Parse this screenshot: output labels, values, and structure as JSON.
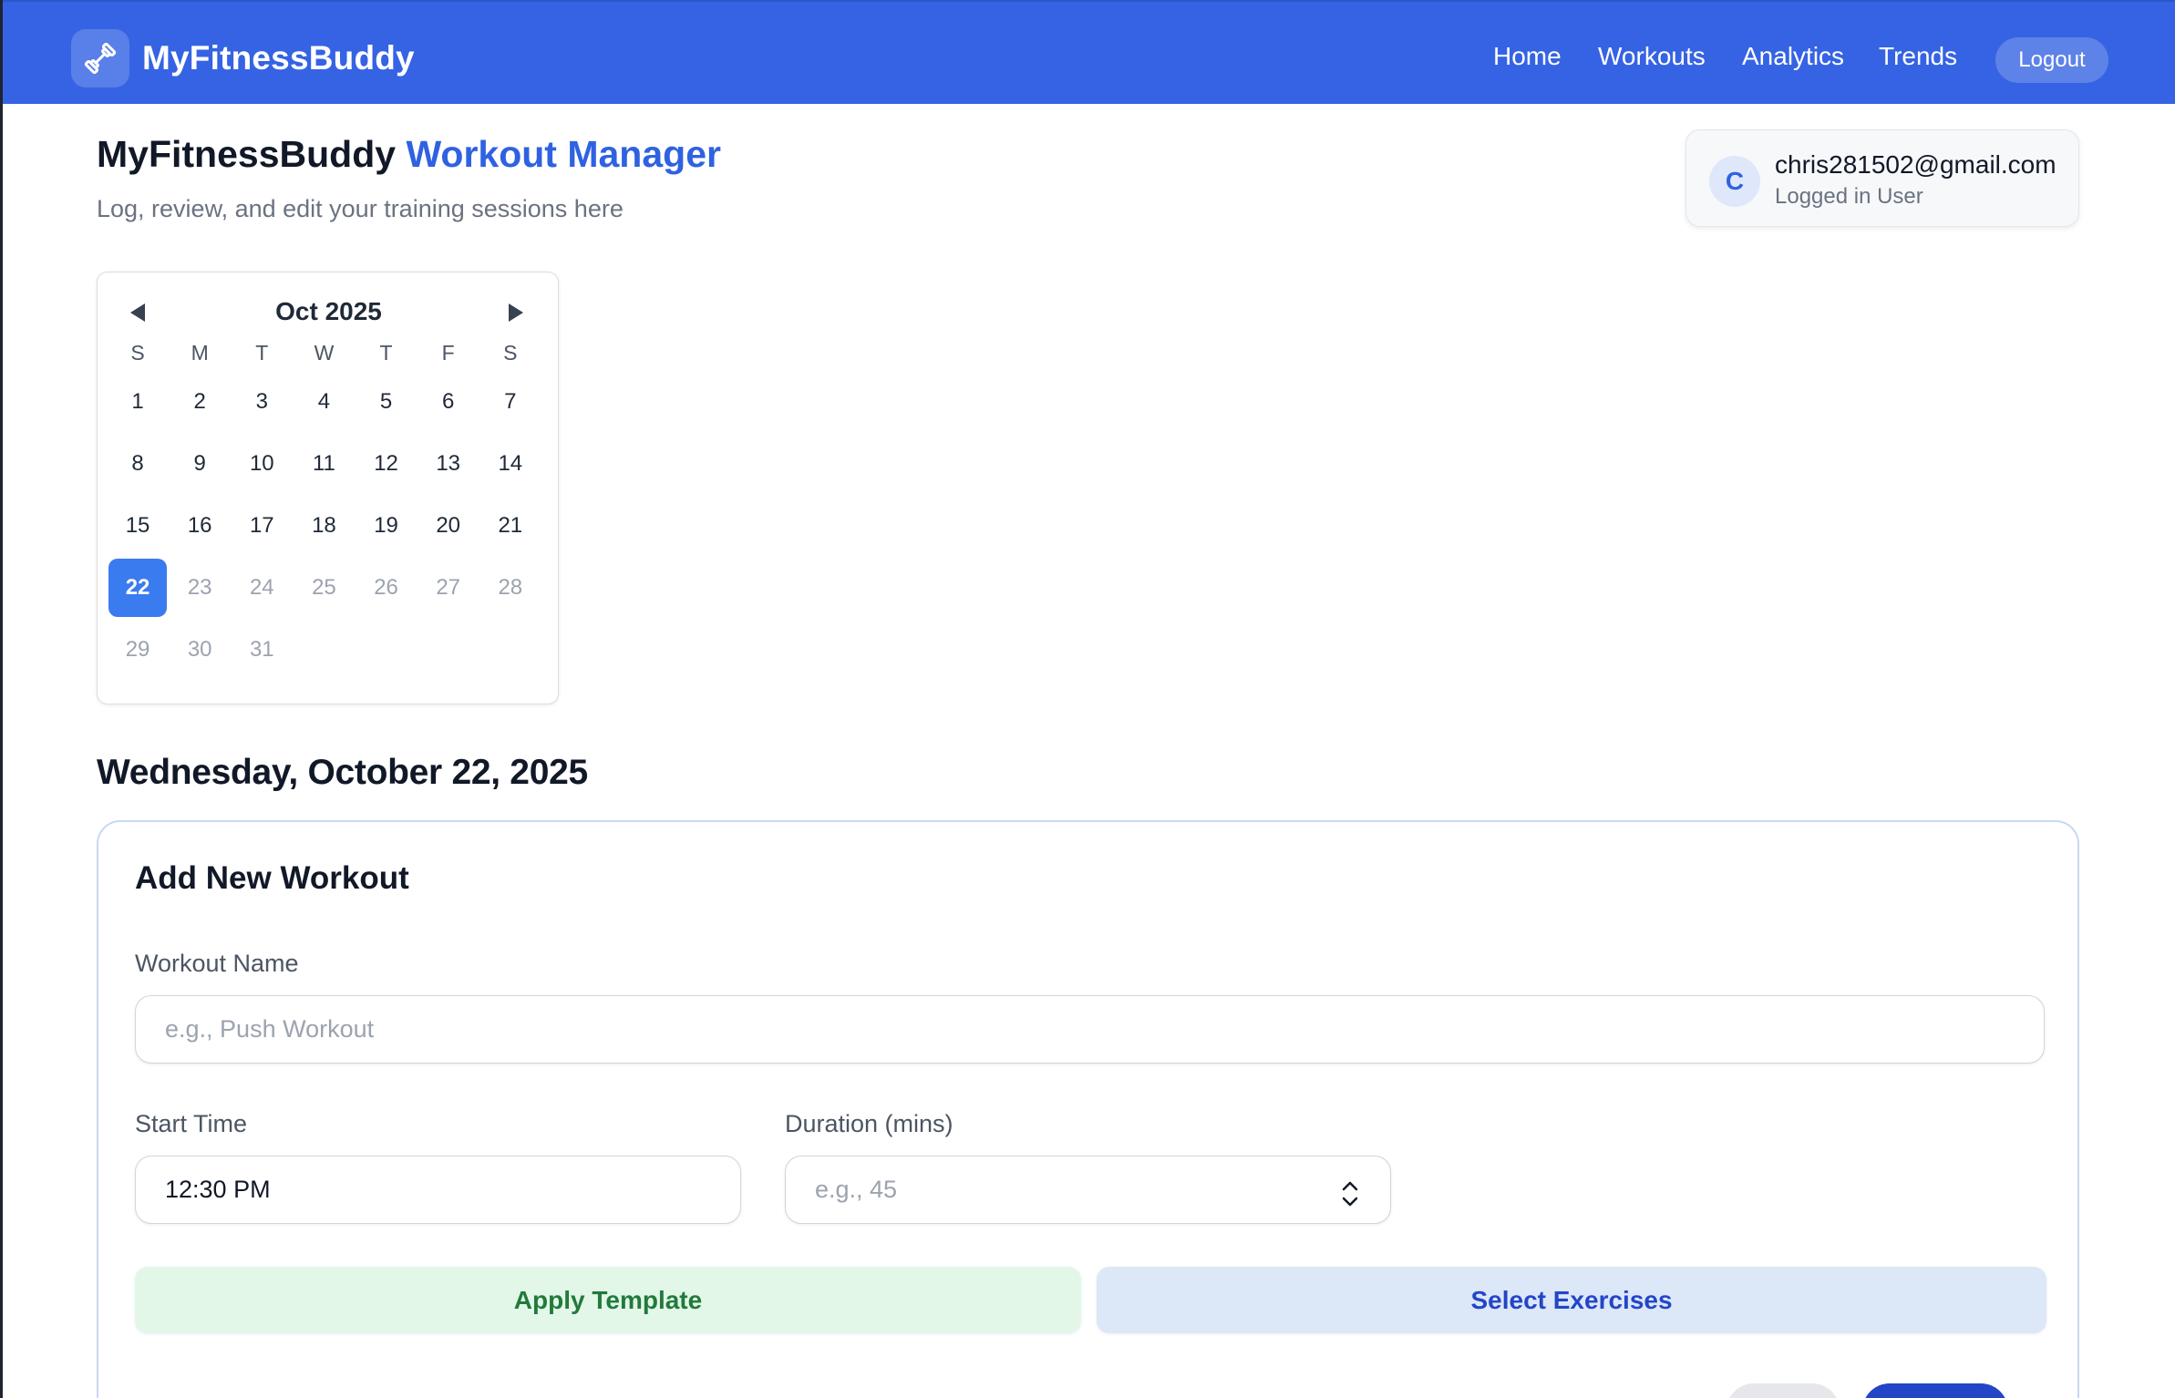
{
  "app": {
    "brand": "MyFitnessBuddy",
    "logo_icon": "dumbbell-icon"
  },
  "nav": {
    "items": [
      "Home",
      "Workouts",
      "Analytics",
      "Trends"
    ],
    "logout": "Logout"
  },
  "header": {
    "title_main": "MyFitnessBuddy",
    "title_accent": "Workout Manager",
    "subtitle": "Log, review, and edit your training sessions here"
  },
  "user": {
    "initial": "C",
    "email": "chris281502@gmail.com",
    "role": "Logged in User"
  },
  "calendar": {
    "month_label": "Oct 2025",
    "weekdays": [
      "S",
      "M",
      "T",
      "W",
      "T",
      "F",
      "S"
    ],
    "weeks": [
      [
        "1",
        "2",
        "3",
        "4",
        "5",
        "6",
        "7"
      ],
      [
        "8",
        "9",
        "10",
        "11",
        "12",
        "13",
        "14"
      ],
      [
        "15",
        "16",
        "17",
        "18",
        "19",
        "20",
        "21"
      ],
      [
        "22",
        "23",
        "24",
        "25",
        "26",
        "27",
        "28"
      ],
      [
        "29",
        "30",
        "31",
        "",
        "",
        "",
        ""
      ]
    ],
    "selected_day": "22",
    "prev_icon": "caret-left-icon",
    "next_icon": "caret-right-icon"
  },
  "selected_date_heading": "Wednesday, October 22, 2025",
  "form": {
    "title": "Add New Workout",
    "workout_name_label": "Workout Name",
    "workout_name_placeholder": "e.g., Push Workout",
    "workout_name_value": "",
    "start_time_label": "Start Time",
    "start_time_value": "12:30 PM",
    "duration_label": "Duration (mins)",
    "duration_placeholder": "e.g., 45",
    "duration_value": "",
    "apply_template": "Apply Template",
    "select_exercises": "Select Exercises"
  },
  "colors": {
    "nav_bg": "#3563e3",
    "accent": "#2f62e0",
    "selected_day": "#3b7bf0",
    "template_bg": "#e2f7e8",
    "template_text": "#217a3c",
    "exercises_bg": "#dce7f8",
    "exercises_text": "#2346c7"
  }
}
